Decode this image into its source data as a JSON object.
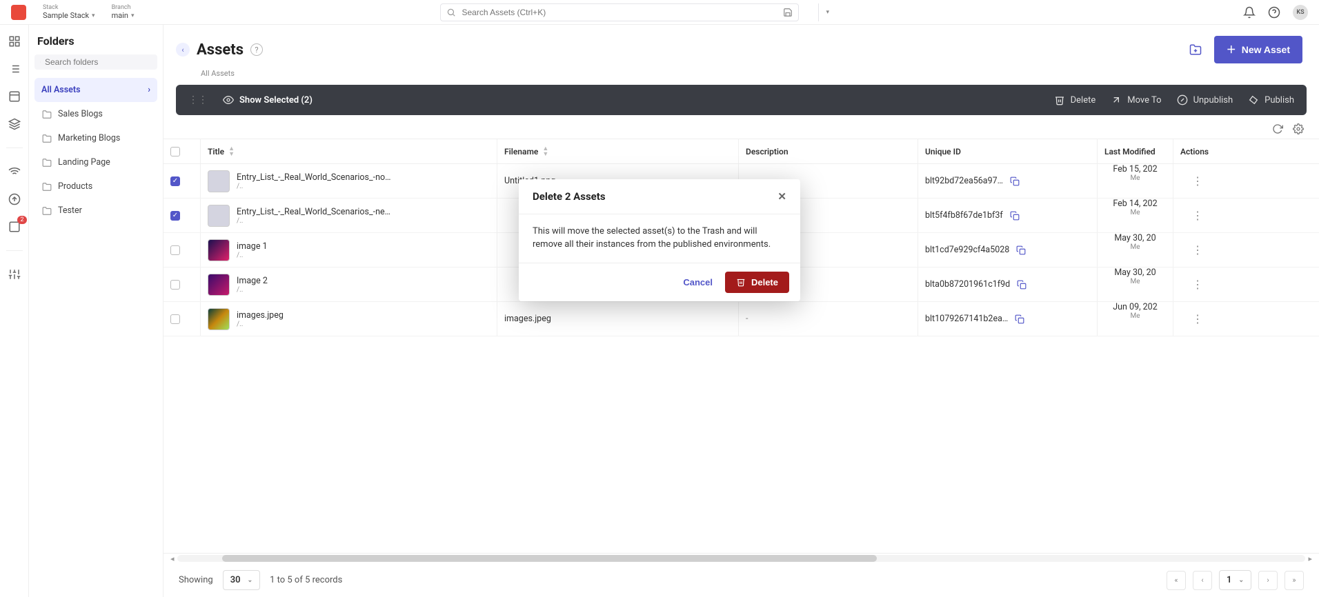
{
  "topbar": {
    "stack_label": "Stack",
    "stack_value": "Sample Stack",
    "branch_label": "Branch",
    "branch_value": "main",
    "search_placeholder": "Search Assets (Ctrl+K)",
    "user_initials": "KS"
  },
  "rail": {
    "badge_count": "2"
  },
  "folders": {
    "heading": "Folders",
    "search_placeholder": "Search folders",
    "active": "All Assets",
    "items": [
      "Sales Blogs",
      "Marketing Blogs",
      "Landing Page",
      "Products",
      "Tester"
    ]
  },
  "page": {
    "title": "Assets",
    "breadcrumb": "All Assets",
    "new_asset_label": "New Asset"
  },
  "selbar": {
    "show_selected": "Show Selected (2)",
    "delete": "Delete",
    "move_to": "Move To",
    "unpublish": "Unpublish",
    "publish": "Publish"
  },
  "table": {
    "cols": {
      "title": "Title",
      "filename": "Filename",
      "description": "Description",
      "unique_id": "Unique ID",
      "last_modified": "Last Modified",
      "actions": "Actions"
    },
    "rows": [
      {
        "checked": true,
        "thumb_class": "",
        "title": "Entry_List_-_Real_World_Scenarios_-no…",
        "path": "/..",
        "filename": "Untitled1.png",
        "description": "-",
        "uid": "blt92bd72ea56a97…",
        "modified": "Feb 15, 202",
        "modified_by": "Me"
      },
      {
        "checked": true,
        "thumb_class": "",
        "title": "Entry_List_-_Real_World_Scenarios_-ne…",
        "path": "/..",
        "filename": "",
        "description": "-",
        "uid": "blt5f4fb8f67de1bf3f",
        "modified": "Feb 14, 202",
        "modified_by": "Me"
      },
      {
        "checked": false,
        "thumb_class": "img1",
        "title": "image 1",
        "path": "/..",
        "filename": "",
        "description": "-",
        "uid": "blt1cd7e929cf4a5028",
        "modified": "May 30, 20",
        "modified_by": "Me"
      },
      {
        "checked": false,
        "thumb_class": "img2",
        "title": "Image 2",
        "path": "/..",
        "filename": "",
        "description": "-",
        "uid": "blta0b87201961c1f9d",
        "modified": "May 30, 20",
        "modified_by": "Me"
      },
      {
        "checked": false,
        "thumb_class": "img3",
        "title": "images.jpeg",
        "path": "/..",
        "filename": "images.jpeg",
        "description": "-",
        "uid": "blt1079267141b2ea…",
        "modified": "Jun 09, 202",
        "modified_by": "Me"
      }
    ]
  },
  "pager": {
    "showing": "Showing",
    "page_size": "30",
    "summary": "1 to 5 of 5 records",
    "page": "1"
  },
  "modal": {
    "title": "Delete 2 Assets",
    "body": "This will move the selected asset(s) to the Trash and will remove all their instances from the published environments.",
    "cancel": "Cancel",
    "delete": "Delete"
  }
}
